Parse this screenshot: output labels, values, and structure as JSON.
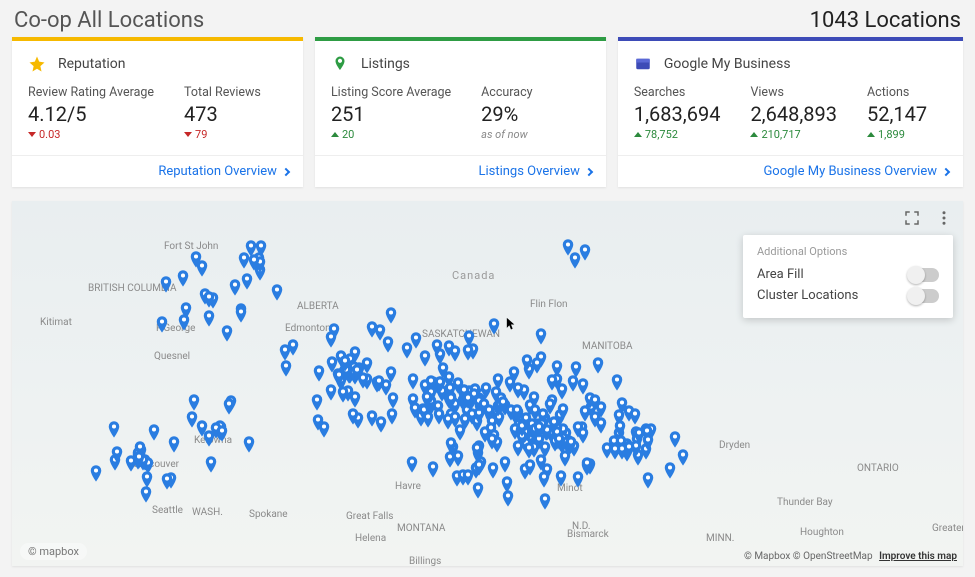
{
  "header": {
    "title": "Co-op All Locations",
    "count_label": "1043 Locations"
  },
  "cards": {
    "reputation": {
      "title": "Reputation",
      "stats": [
        {
          "label": "Review Rating Average",
          "value": "4.12/5",
          "delta": "0.03",
          "dir": "down"
        },
        {
          "label": "Total Reviews",
          "value": "473",
          "delta": "79",
          "dir": "down"
        }
      ],
      "footer": "Reputation Overview"
    },
    "listings": {
      "title": "Listings",
      "stats": [
        {
          "label": "Listing Score Average",
          "value": "251",
          "delta": "20",
          "dir": "up"
        },
        {
          "label": "Accuracy",
          "value": "29%",
          "delta": "as of now",
          "dir": "neutral"
        }
      ],
      "footer": "Listings Overview"
    },
    "gmb": {
      "title": "Google My Business",
      "stats": [
        {
          "label": "Searches",
          "value": "1,683,694",
          "delta": "78,752",
          "dir": "up"
        },
        {
          "label": "Views",
          "value": "2,648,893",
          "delta": "210,717",
          "dir": "up"
        },
        {
          "label": "Actions",
          "value": "52,147",
          "delta": "1,899",
          "dir": "up"
        }
      ],
      "footer": "Google My Business Overview"
    }
  },
  "map": {
    "options_title": "Additional Options",
    "option_area": "Area Fill",
    "option_cluster": "Cluster Locations",
    "mapbox": "© mapbox",
    "attr_mapbox": "© Mapbox",
    "attr_osm": "© OpenStreetMap",
    "improve": "Improve this map",
    "labels": {
      "canada": "Canada",
      "bc": "BRITISH COLUMBIA",
      "alberta": "ALBERTA",
      "sask": "SASKATCHEWAN",
      "manitoba": "MANITOBA",
      "ontario": "ONTARIO",
      "montana": "MONTANA",
      "nd": "N.D.",
      "minn": "MINN.",
      "wash": "WASH.",
      "kitimat": "Kitimat",
      "ftjohn": "Fort St John",
      "pgeorge": "P.George",
      "quesnel": "Quesnel",
      "kelowna": "Kelowna",
      "vancouver": "Vancouver",
      "seattle": "Seattle",
      "spokane": "Spokane",
      "helena": "Helena",
      "billings": "Billings",
      "greatfalls": "Great Falls",
      "minot": "Minot",
      "bismarck": "Bismarck",
      "havre": "Havre",
      "edmonton": "Edmonton",
      "flinflon": "Flin Flon",
      "thunderbay": "Thunder Bay",
      "dryden": "Dryden",
      "houghton": "Houghton",
      "gsudbury": "Greater Sudbury"
    }
  }
}
